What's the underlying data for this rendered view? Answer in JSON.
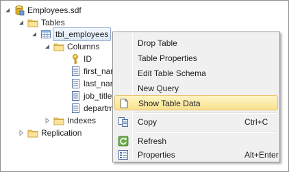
{
  "tree": {
    "root": {
      "label": "Employees.sdf",
      "icon": "database-icon"
    },
    "tables_folder": {
      "label": "Tables",
      "icon": "folder-icon"
    },
    "selected_table": {
      "label": "tbl_employees",
      "icon": "table-icon"
    },
    "columns_folder": {
      "label": "Columns",
      "icon": "folder-icon"
    },
    "columns": [
      {
        "label": "ID",
        "icon": "key-icon"
      },
      {
        "label": "first_nar",
        "icon": "column-icon"
      },
      {
        "label": "last_nar",
        "icon": "column-icon"
      },
      {
        "label": "job_title",
        "icon": "column-icon"
      },
      {
        "label": "departm",
        "icon": "column-icon"
      }
    ],
    "indexes_folder": {
      "label": "Indexes",
      "icon": "folder-icon"
    },
    "replication_folder": {
      "label": "Replication",
      "icon": "folder-icon"
    }
  },
  "context_menu": {
    "items": [
      {
        "label": "Drop Table",
        "shortcut": ""
      },
      {
        "label": "Table Properties",
        "shortcut": ""
      },
      {
        "label": "Edit Table Schema",
        "shortcut": ""
      },
      {
        "label": "New Query",
        "shortcut": ""
      },
      {
        "label": "Show Table Data",
        "shortcut": "",
        "icon": "document-icon",
        "highlighted": true
      },
      {
        "label": "Copy",
        "shortcut": "Ctrl+C",
        "icon": "copy-icon"
      },
      {
        "label": "Refresh",
        "shortcut": "",
        "icon": "refresh-icon"
      },
      {
        "label": "Properties",
        "shortcut": "Alt+Enter",
        "icon": "properties-icon"
      }
    ]
  },
  "colors": {
    "highlight_fill": "#f8e18f",
    "highlight_border": "#e5c365",
    "selection_border": "#8fa7c8",
    "folder_yellow": "#f5d37a"
  }
}
